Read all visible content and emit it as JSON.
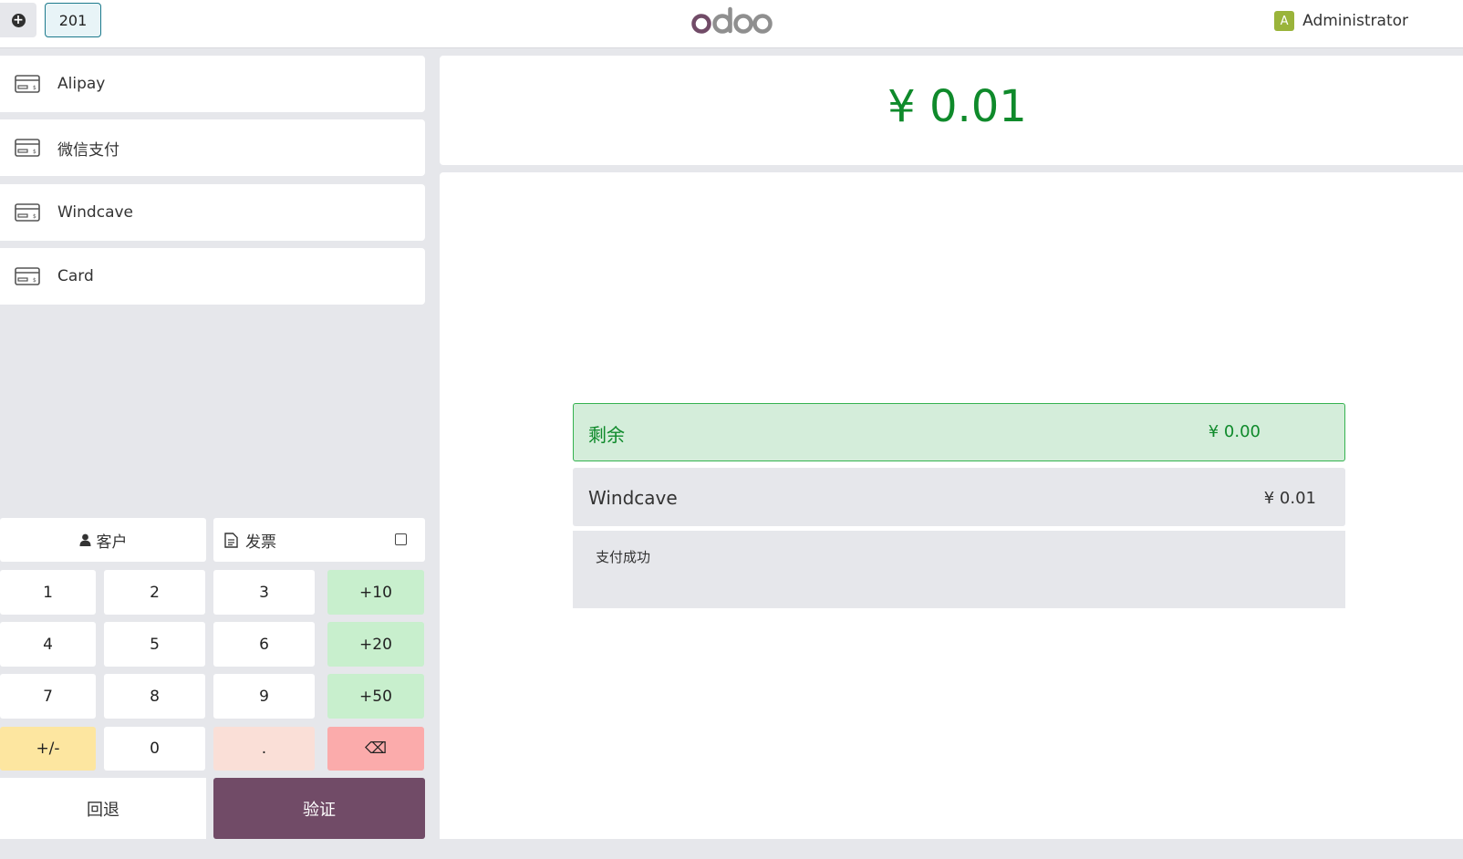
{
  "header": {
    "order_tab": "201",
    "brand": "odoo",
    "user_name": "Administrator",
    "avatar_initial": "A"
  },
  "payment_methods": [
    {
      "label": "Alipay"
    },
    {
      "label": "微信支付"
    },
    {
      "label": "Windcave"
    },
    {
      "label": "Card"
    }
  ],
  "actions": {
    "customer": "客户",
    "invoice": "发票",
    "back": "回退",
    "validate": "验证"
  },
  "numpad": {
    "k1": "1",
    "k2": "2",
    "k3": "3",
    "p10": "+10",
    "k4": "4",
    "k5": "5",
    "k6": "6",
    "p20": "+20",
    "k7": "7",
    "k8": "8",
    "k9": "9",
    "p50": "+50",
    "sign": "+/-",
    "k0": "0",
    "dot": ".",
    "backspace": "⌫"
  },
  "summary": {
    "total": "¥ 0.01",
    "remaining_label": "剩余",
    "remaining_value": "¥ 0.00"
  },
  "payment_lines": [
    {
      "method": "Windcave",
      "amount": "¥ 0.01",
      "status": "支付成功"
    }
  ],
  "colors": {
    "brand": "#714b67",
    "success": "#0f8a2b",
    "accent": "#1c7a8c"
  }
}
